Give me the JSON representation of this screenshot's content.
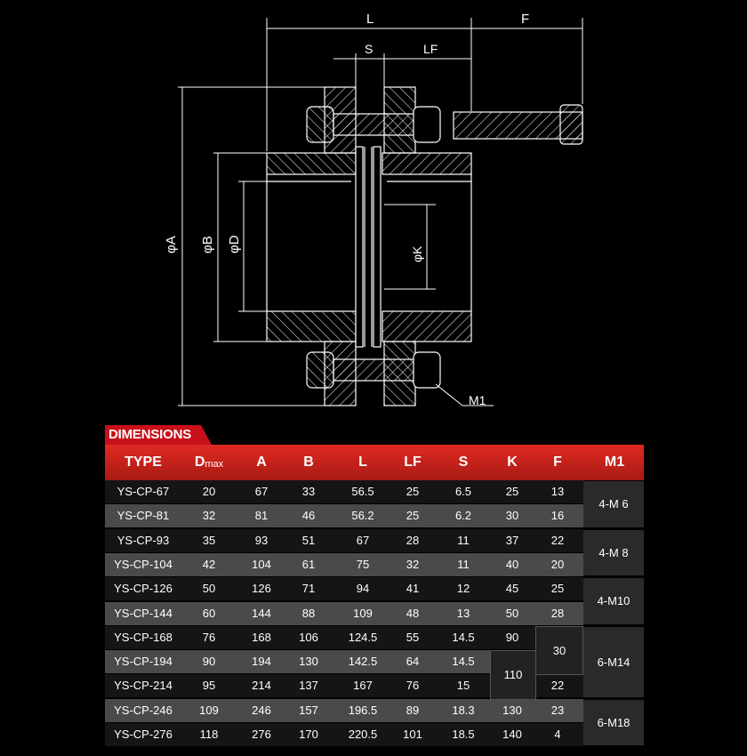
{
  "drawing": {
    "labels": {
      "L": "L",
      "F": "F",
      "S": "S",
      "LF": "LF",
      "A": "φA",
      "B": "φB",
      "D": "φD",
      "K": "φK",
      "M1": "M1"
    }
  },
  "table": {
    "title": "DIMENSIONS",
    "headers": [
      "TYPE",
      "D",
      "A",
      "B",
      "L",
      "LF",
      "S",
      "K",
      "F",
      "M1"
    ],
    "dmax_sub": "max",
    "rows": [
      [
        "YS-CP-67",
        "20",
        "67",
        "33",
        "56.5",
        "25",
        "6.5",
        "25",
        "13"
      ],
      [
        "YS-CP-81",
        "32",
        "81",
        "46",
        "56.2",
        "25",
        "6.2",
        "30",
        "16"
      ],
      [
        "YS-CP-93",
        "35",
        "93",
        "51",
        "67",
        "28",
        "11",
        "37",
        "22"
      ],
      [
        "YS-CP-104",
        "42",
        "104",
        "61",
        "75",
        "32",
        "11",
        "40",
        "20"
      ],
      [
        "YS-CP-126",
        "50",
        "126",
        "71",
        "94",
        "41",
        "12",
        "45",
        "25"
      ],
      [
        "YS-CP-144",
        "60",
        "144",
        "88",
        "109",
        "48",
        "13",
        "50",
        "28"
      ],
      [
        "YS-CP-168",
        "76",
        "168",
        "106",
        "124.5",
        "55",
        "14.5",
        "90",
        ""
      ],
      [
        "YS-CP-194",
        "90",
        "194",
        "130",
        "142.5",
        "64",
        "14.5",
        "",
        ""
      ],
      [
        "YS-CP-214",
        "95",
        "214",
        "137",
        "167",
        "76",
        "15",
        "",
        "22"
      ],
      [
        "YS-CP-246",
        "109",
        "246",
        "157",
        "196.5",
        "89",
        "18.3",
        "130",
        "23"
      ],
      [
        "YS-CP-276",
        "118",
        "276",
        "170",
        "220.5",
        "101",
        "18.5",
        "140",
        "4"
      ]
    ],
    "merged": {
      "k_110": "110",
      "f_30": "30"
    },
    "m1_groups": [
      "4-M 6",
      "4-M 8",
      "4-M10",
      "6-M14",
      "6-M18"
    ]
  }
}
